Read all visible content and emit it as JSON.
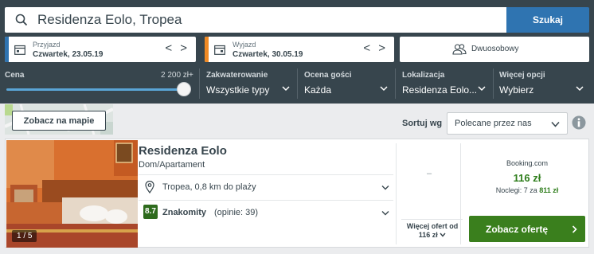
{
  "search": {
    "query": "Residenza Eolo, Tropea",
    "button_label": "Szukaj"
  },
  "dates": {
    "checkin_label": "Przyjazd",
    "checkin_value": "Czwartek, 23.05.19",
    "checkout_label": "Wyjazd",
    "checkout_value": "Czwartek, 30.05.19",
    "arrows": "< >"
  },
  "room": {
    "label": "Dwuosobowy"
  },
  "filters": {
    "price_label": "Cena",
    "price_max": "2 200 zł+",
    "price_level": 1.0,
    "accommodation_label": "Zakwaterowanie",
    "accommodation_value": "Wszystkie typy",
    "rating_label": "Ocena gości",
    "rating_value": "Każda",
    "location_label": "Lokalizacja",
    "location_value": "Residenza Eolo...",
    "more_label": "Więcej opcji",
    "more_value": "Wybierz"
  },
  "map": {
    "button_label": "Zobacz na mapie"
  },
  "sort": {
    "label": "Sortuj wg",
    "value": "Polecane przez nas"
  },
  "result": {
    "name": "Residenza Eolo",
    "type": "Dom/Apartament",
    "location": "Tropea, 0,8 km do plaży",
    "rating_score": "8.7",
    "rating_word": "Znakomity",
    "rating_count": "(opinie: 39)",
    "photo_counter": "1 / 5",
    "empty_slot": "–",
    "more_offers_line1": "Więcej ofert od",
    "more_offers_line2": "116 zł",
    "provider": "Booking.com",
    "price": "116 zł",
    "nights_prefix": "Noclegi: 7 za",
    "nights_total": "811 zł",
    "deal_button": "Zobacz ofertę"
  },
  "colors": {
    "header_bg": "#37454d",
    "search_button": "#2f74b1",
    "checkin_stripe": "#2f74b1",
    "checkout_stripe": "#f08a24",
    "deal_button": "#3a7f1d",
    "price_green": "#2e7d1b",
    "rating_badge": "#2e6b1d"
  },
  "icons": {
    "search": "search-icon",
    "calendar": "calendar-icon",
    "room": "people-icon",
    "pin": "location-pin-icon",
    "info": "info-icon",
    "chevron": "chevron-down-icon"
  }
}
